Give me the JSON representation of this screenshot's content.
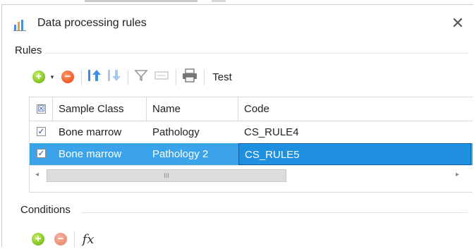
{
  "window": {
    "title": "Data processing rules",
    "close_glyph": "✕"
  },
  "rules_group": {
    "label": "Rules",
    "toolbar": {
      "add_icon": "add-icon",
      "remove_icon": "remove-icon",
      "move_up_icon": "move-up-icon",
      "move_down_icon": "move-down-icon",
      "filter_icon": "filter-icon",
      "clear_filter_icon": "clear-filter-icon",
      "print_icon": "print-icon",
      "test_label": "Test"
    },
    "grid": {
      "columns": [
        "Sample Class",
        "Name",
        "Code"
      ],
      "rows": [
        {
          "checked": true,
          "sample_class": "Bone marrow",
          "name": "Pathology",
          "code": "CS_RULE4",
          "selected": false
        },
        {
          "checked": true,
          "sample_class": "Bone marrow",
          "name": "Pathology 2",
          "code": "CS_RULE5",
          "selected": true
        }
      ],
      "scroll_thumb_glyph": "III"
    }
  },
  "conditions_group": {
    "label": "Conditions",
    "fx_label": "fx"
  },
  "colors": {
    "selection": "#3aa3ea",
    "add": "#7cbf1e",
    "remove": "#ec5a24"
  }
}
